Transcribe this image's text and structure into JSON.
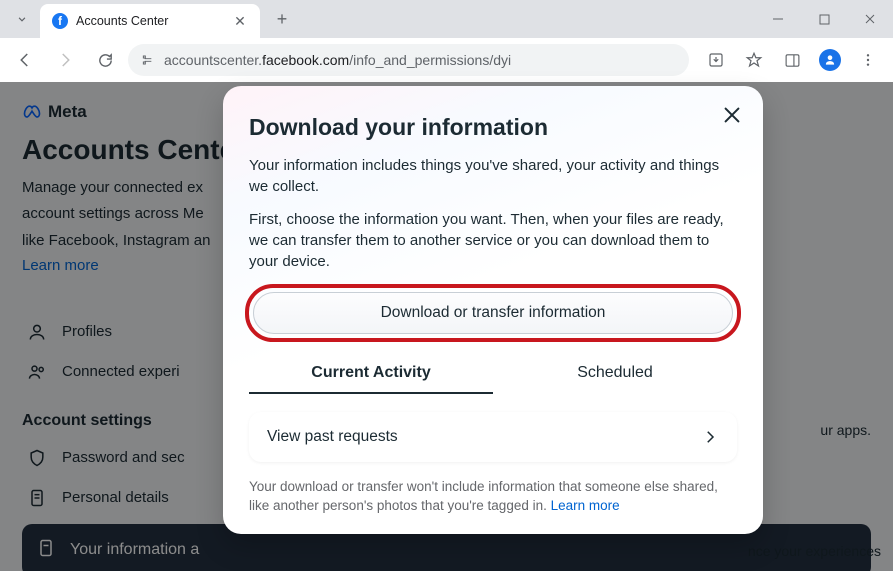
{
  "browser": {
    "tab_title": "Accounts Center",
    "url_prefix": "accountscenter.",
    "url_domain": "facebook.com",
    "url_path": "/info_and_permissions/dyi"
  },
  "page": {
    "brand": "Meta",
    "title": "Accounts Center",
    "desc1": "Manage your connected ex",
    "desc2": "account settings across Me",
    "desc3": "like Facebook, Instagram an",
    "learn": "Learn more",
    "nav1": "Profiles",
    "nav2": "Connected experi",
    "sec": "Account settings",
    "nav3": "Password and sec",
    "nav4": "Personal details",
    "nav5": "Your information a",
    "right_text": "ur apps.",
    "bottom_text": "nce your experiences"
  },
  "modal": {
    "title": "Download your information",
    "p1": "Your information includes things you've shared, your activity and things we collect.",
    "p2": "First, choose the information you want. Then, when your files are ready, we can transfer them to another service or you can download them to your device.",
    "btn": "Download or transfer information",
    "tab1": "Current Activity",
    "tab2": "Scheduled",
    "past": "View past requests",
    "foot": "Your download or transfer won't include information that someone else shared, like another person's photos that you're tagged in. ",
    "foot_link": "Learn more"
  }
}
